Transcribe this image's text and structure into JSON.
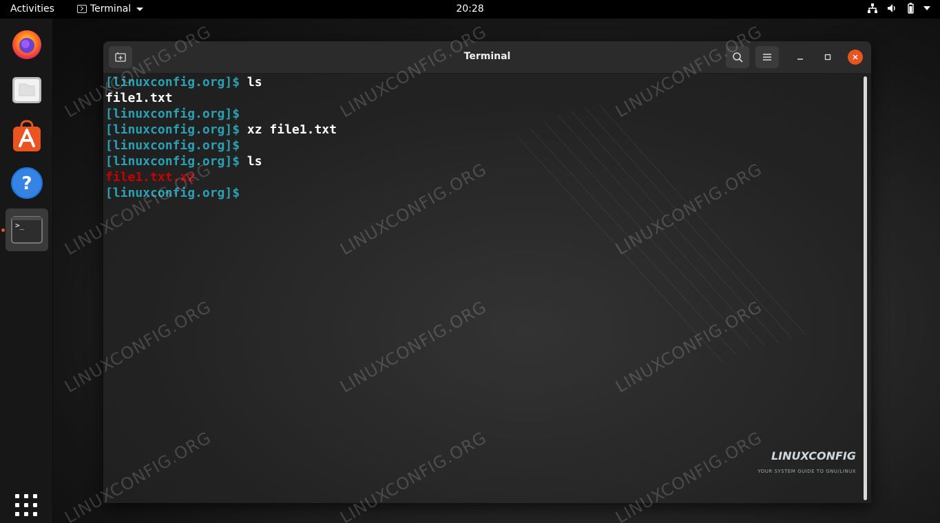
{
  "topbar": {
    "activities": "Activities",
    "app_name": "Terminal",
    "clock": "20:28"
  },
  "dock": {
    "items": [
      {
        "name": "firefox",
        "icon": "firefox-icon"
      },
      {
        "name": "files",
        "icon": "files-icon"
      },
      {
        "name": "software",
        "icon": "software-center-icon"
      },
      {
        "name": "help",
        "icon": "help-icon"
      },
      {
        "name": "terminal",
        "icon": "terminal-icon",
        "active": true
      }
    ],
    "show_apps_icon": "apps-grid-icon"
  },
  "window": {
    "title": "Terminal",
    "new_tab_icon": "new-tab-icon",
    "search_icon": "search-icon",
    "menu_icon": "hamburger-menu-icon",
    "minimize_icon": "minimize-icon",
    "maximize_icon": "maximize-icon",
    "close_icon": "close-icon"
  },
  "terminal": {
    "prompt": "[linuxconfig.org]$",
    "lines": [
      {
        "prompt": "[linuxconfig.org]$",
        "cmd": " ls"
      },
      {
        "output": "file1.txt"
      },
      {
        "prompt": "[linuxconfig.org]$",
        "cmd": ""
      },
      {
        "prompt": "[linuxconfig.org]$",
        "cmd": " xz file1.txt"
      },
      {
        "prompt": "[linuxconfig.org]$",
        "cmd": ""
      },
      {
        "prompt": "[linuxconfig.org]$",
        "cmd": " ls"
      },
      {
        "output_red": "file1.txt.xz"
      },
      {
        "prompt": "[linuxconfig.org]$",
        "cmd": ""
      }
    ]
  },
  "watermark": "LINUXCONFIG.ORG",
  "brand": {
    "name": "LINUXCONFIG",
    "tagline": "YOUR SYSTEM GUIDE TO GNU/LINUX"
  },
  "colors": {
    "accent": "#e95420",
    "prompt": "#2aa1b3",
    "compressed_file": "#cc0000"
  }
}
